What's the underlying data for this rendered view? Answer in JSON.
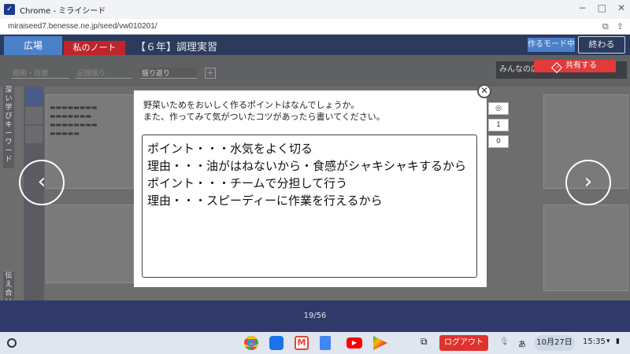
{
  "window": {
    "title": "Chrome - ミライシード",
    "url": "miraiseed7.benesse.ne.jp/seed/vw010201/"
  },
  "header": {
    "tab_hiroba": "広場",
    "tab_note": "私のノート",
    "page_title": "【６年】調理実習",
    "mode_button": "作るモード中",
    "end_button": "終わる"
  },
  "toolbar": {
    "fields": [
      {
        "label": "観刷・目標"
      },
      {
        "label": "記録振り"
      },
      {
        "label": "振り返り"
      }
    ]
  },
  "side": {
    "deep_learning": "深い学び",
    "keyword": "キーワード",
    "tsutaeai": "伝え合い"
  },
  "minna_label": "みんなの広場",
  "share_button": "共有する",
  "mini_counts": [
    "1",
    "0"
  ],
  "modal": {
    "question_1": "野菜いためをおいしく作るポイントはなんでしょうか。",
    "question_2": "また、作ってみて気がついたコツがあったら書いてください。",
    "answer_lines": [
      "ポイント・・・水気をよく切る",
      "理由・・・油がはねないから・食感がシャキシャキするから",
      "ポイント・・・チームで分担して行う",
      "理由・・・スピーディーに作業を行えるから"
    ]
  },
  "pager": {
    "page": "19/56"
  },
  "shelf": {
    "logout": "ログアウト",
    "ime": "あ",
    "date": "10月27日",
    "time": "15:35"
  }
}
